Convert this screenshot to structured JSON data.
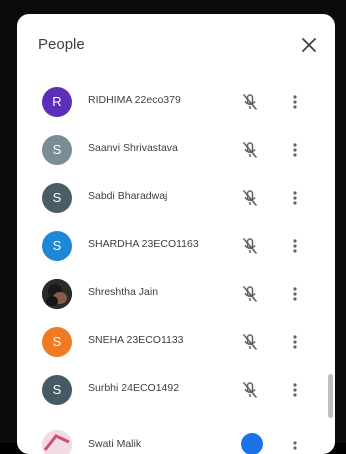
{
  "panel": {
    "title": "People",
    "close_icon": "close-icon"
  },
  "people": [
    {
      "initial": "R",
      "name": "RIDHIMA 22eco379",
      "avatar_color": "#5c2fb8"
    },
    {
      "initial": "S",
      "name": "Saanvi Shrivastava",
      "avatar_color": "#7a8d96"
    },
    {
      "initial": "S",
      "name": "Sabdi Bharadwaj",
      "avatar_color": "#4a5c66"
    },
    {
      "initial": "S",
      "name": "SHARDHA 23ECO1163",
      "avatar_color": "#1e88d8"
    },
    {
      "initial": "",
      "name": "Shreshtha Jain",
      "avatar_color": "#3a3a3a"
    },
    {
      "initial": "S",
      "name": "SNEHA 23ECO1133",
      "avatar_color": "#ef7a22"
    },
    {
      "initial": "S",
      "name": "Surbhi 24ECO1492",
      "avatar_color": "#455a64"
    }
  ],
  "partial_row": {
    "name": "Swati Malik"
  },
  "icons": {
    "mic": "mic-off-icon",
    "more": "more-vert-icon"
  }
}
